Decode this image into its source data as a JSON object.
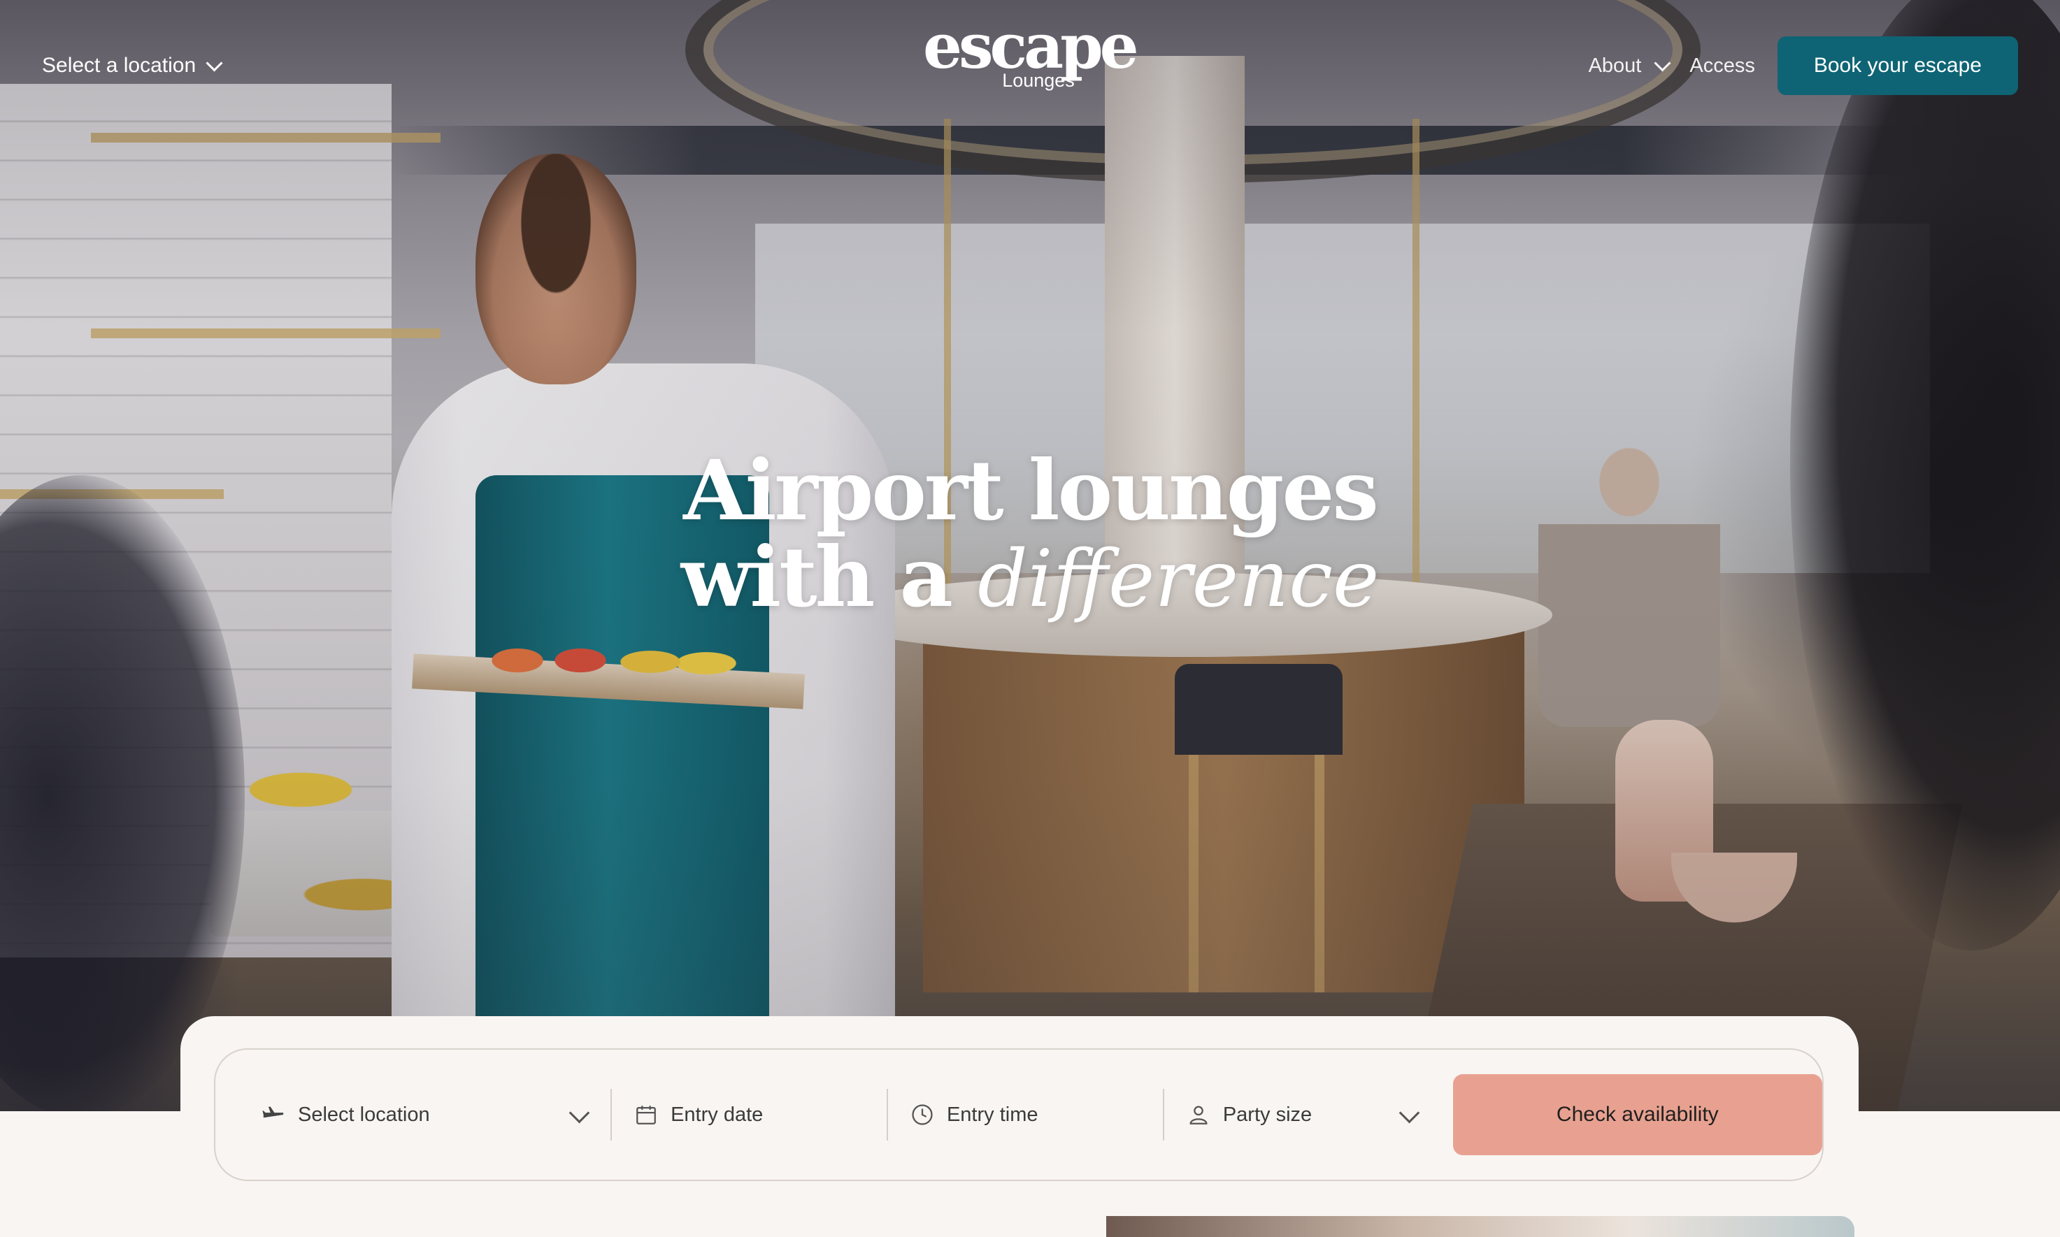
{
  "nav": {
    "location_label": "Select a location",
    "about_label": "About",
    "access_label": "Access",
    "book_label": "Book your escape"
  },
  "logo": {
    "word": "escape",
    "sub": "Lounges"
  },
  "hero": {
    "line1": "Airport lounges",
    "line2_prefix": "with a",
    "line2_script": "difference"
  },
  "booking": {
    "location_placeholder": "Select location",
    "date_placeholder": "Entry date",
    "time_placeholder": "Entry time",
    "party_placeholder": "Party size",
    "submit_label": "Check availability"
  },
  "colors": {
    "brand_teal": "#0e6474",
    "accent_coral": "#e8a190",
    "page_background": "#f8f5f2"
  },
  "icons": {
    "plane": "plane-icon",
    "calendar": "calendar-icon",
    "clock": "clock-icon",
    "person": "person-icon",
    "chevron": "chevron-down-icon"
  }
}
